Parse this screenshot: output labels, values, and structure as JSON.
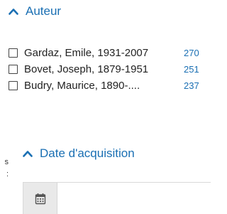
{
  "facets": {
    "auteur": {
      "title": "Auteur",
      "items": [
        {
          "label": "Gardaz, Emile, 1931-2007",
          "count": "270"
        },
        {
          "label": "Bovet, Joseph, 1879-1951",
          "count": "251"
        },
        {
          "label": "Budry, Maurice, 1890-....",
          "count": "237"
        }
      ]
    },
    "date_acquisition": {
      "title": "Date d'acquisition"
    }
  },
  "left_fragments": [
    "s",
    ":"
  ],
  "icons": {
    "collapse": "chevron-up-icon",
    "calendar": "calendar-icon"
  },
  "colors": {
    "accent": "#1a6fb3"
  }
}
